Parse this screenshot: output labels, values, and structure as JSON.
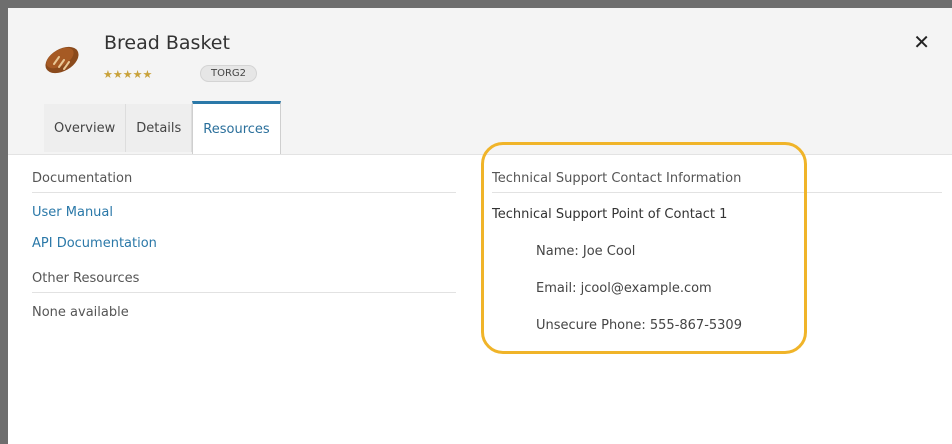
{
  "app": {
    "title": "Bread Basket",
    "rating_stars": "★★★★★",
    "tag": "TORG2",
    "close_label": "✕"
  },
  "tabs": [
    {
      "label": "Overview",
      "active": false
    },
    {
      "label": "Details",
      "active": false
    },
    {
      "label": "Resources",
      "active": true
    }
  ],
  "left": {
    "documentation_header": "Documentation",
    "links": [
      "User Manual",
      "API Documentation"
    ],
    "other_resources_header": "Other Resources",
    "other_resources_value": "None available"
  },
  "right": {
    "header": "Technical Support Contact Information",
    "poc_title": "Technical Support Point of Contact 1",
    "name": "Name: Joe Cool",
    "email": "Email: jcool@example.com",
    "phone": "Unsecure Phone: 555-867-5309"
  },
  "colors": {
    "link": "#2a78a8",
    "highlight": "#f0b429",
    "stars": "#c9a23a"
  },
  "icons": {
    "app_icon": "bread-loaf-icon",
    "close": "close-icon"
  }
}
